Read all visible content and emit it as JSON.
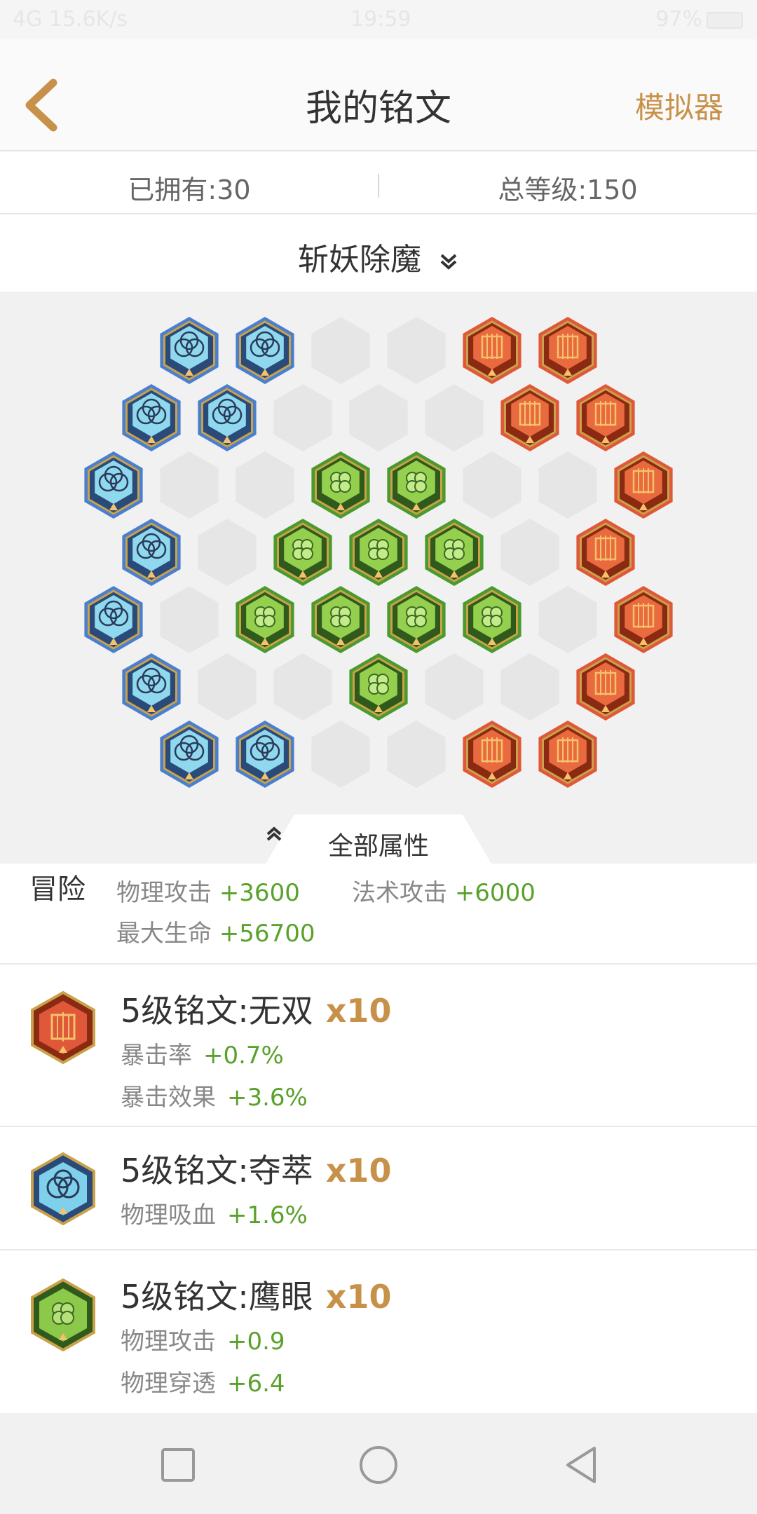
{
  "status_bar": {
    "left": "4G 15.6K/s",
    "time": "19:59",
    "battery": "97%"
  },
  "header": {
    "title": "我的铭文",
    "simulator_label": "模拟器",
    "accent_color": "#c8914a"
  },
  "summary": {
    "owned": "已拥有:30",
    "total_level": "总等级:150"
  },
  "page_selector": {
    "label": "斩妖除魔",
    "icon": "double-chevron-down-icon"
  },
  "rune_board": {
    "colors": {
      "blue": "#4a7fd0",
      "red": "#e0583a",
      "green": "#4a9a2e",
      "empty": "#e6e6e6"
    },
    "red_slots": 10,
    "blue_slots": 10,
    "green_slots": 10
  },
  "attributes_tab": {
    "label": "全部属性",
    "icon": "double-chevron-up-icon"
  },
  "stats": {
    "category": "冒险",
    "items": [
      {
        "name": "物理攻击",
        "value": "+3600"
      },
      {
        "name": "法术攻击",
        "value": "+6000"
      },
      {
        "name": "最大生命",
        "value": "+56700"
      }
    ]
  },
  "runes": [
    {
      "name": "5级铭文:无双",
      "count": "x10",
      "color": "red",
      "attrs": [
        {
          "name": "暴击率",
          "value": "+0.7%"
        },
        {
          "name": "暴击效果",
          "value": "+3.6%"
        }
      ]
    },
    {
      "name": "5级铭文:夺萃",
      "count": "x10",
      "color": "blue",
      "attrs": [
        {
          "name": "物理吸血",
          "value": "+1.6%"
        }
      ]
    },
    {
      "name": "5级铭文:鹰眼",
      "count": "x10",
      "color": "green",
      "attrs": [
        {
          "name": "物理攻击",
          "value": "+0.9"
        },
        {
          "name": "物理穿透",
          "value": "+6.4"
        }
      ]
    }
  ],
  "nav": {
    "recent": "square-icon",
    "home": "circle-icon",
    "back": "triangle-back-icon"
  }
}
